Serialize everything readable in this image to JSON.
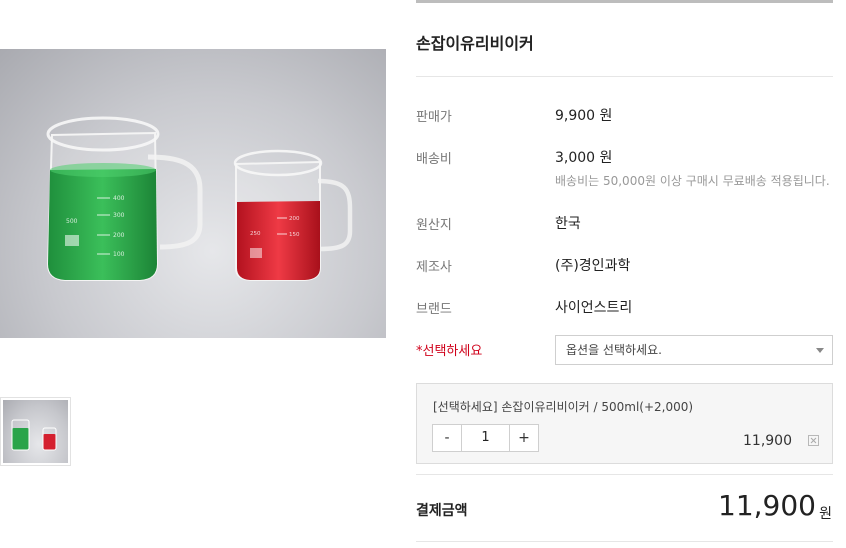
{
  "product": {
    "title": "손잡이유리비이커"
  },
  "info": {
    "price_label": "판매가",
    "price_value": "9,900 원",
    "shipping_label": "배송비",
    "shipping_value": "3,000 원",
    "shipping_note": "배송비는 50,000원 이상 구매시 무료배송 적용됩니다.",
    "origin_label": "원산지",
    "origin_value": "한국",
    "maker_label": "제조사",
    "maker_value": "(주)경인과학",
    "brand_label": "브랜드",
    "brand_value": "사이언스트리"
  },
  "option": {
    "required_mark": "*",
    "label": "선택하세요",
    "placeholder": "옵션을 선택하세요."
  },
  "selected": {
    "name": "[선택하세요] 손잡이유리비이커 / 500ml(+2,000)",
    "minus": "-",
    "quantity": "1",
    "plus": "+",
    "price": "11,900"
  },
  "total": {
    "label": "결제금액",
    "value": "11,900",
    "unit": "원"
  },
  "image_text": {
    "large_beaker_marks": [
      "400",
      "300",
      "200",
      "100",
      "500"
    ],
    "small_beaker_marks": [
      "200",
      "150",
      "250"
    ]
  },
  "colors": {
    "green_liquid": "#2aa44a",
    "red_liquid": "#d4202f",
    "required": "#d0021b"
  }
}
